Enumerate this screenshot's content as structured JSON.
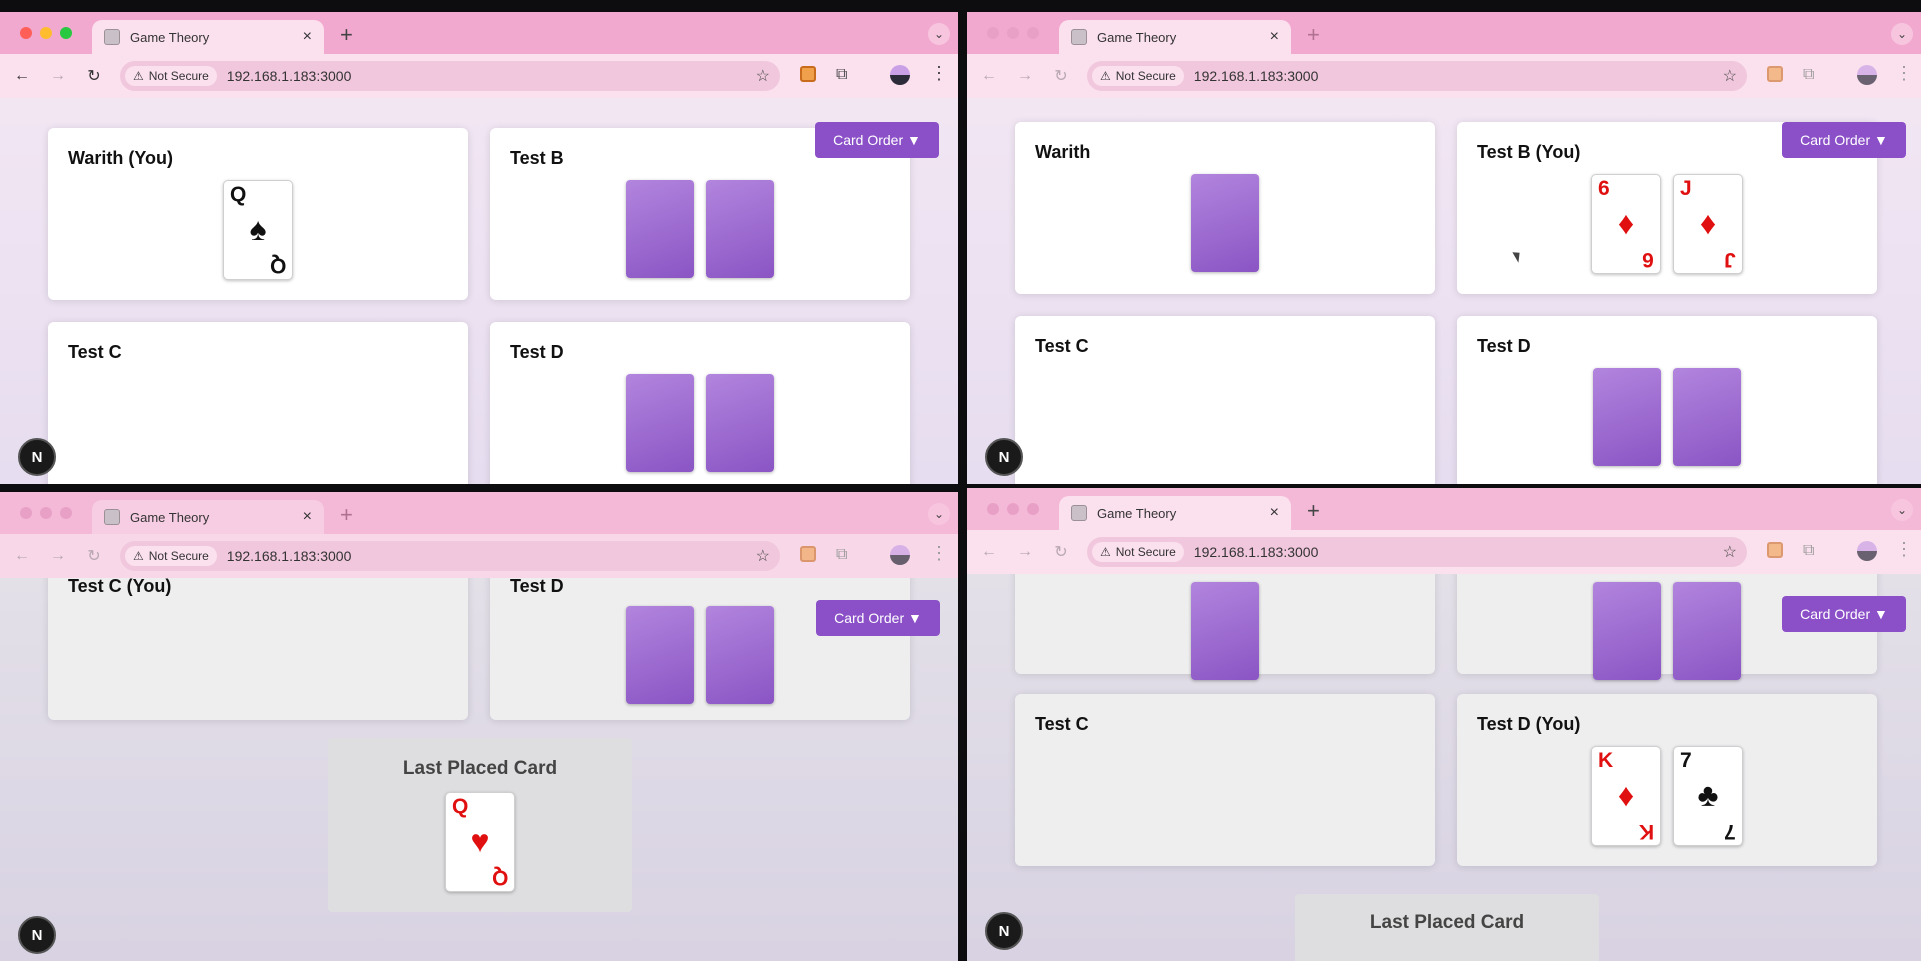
{
  "tab": {
    "title": "Game Theory"
  },
  "address": {
    "security": "Not Secure",
    "url": "192.168.1.183:3000"
  },
  "ui": {
    "card_order": "Card Order ▼",
    "last_placed": "Last Placed Card",
    "next_badge": "N"
  },
  "icons": {
    "back": "arrow-left-icon",
    "forward": "arrow-right-icon",
    "reload": "reload-icon",
    "star": "star-icon",
    "extension": "puzzle-icon",
    "menu": "kebab-icon",
    "warning": "warning-icon"
  },
  "colors": {
    "accent": "#8b50c8",
    "card_back": "#9b6bd3",
    "red_suit": "#e01010",
    "tab_strip": "#f2a9cf"
  },
  "windows": [
    {
      "players": [
        {
          "name": "Warith (You)",
          "cards": [
            {
              "rank": "Q",
              "suit": "♠",
              "color": "blk"
            }
          ]
        },
        {
          "name": "Test B",
          "backs": 2
        },
        {
          "name": "Test C",
          "backs": 0
        },
        {
          "name": "Test D",
          "backs": 2
        }
      ]
    },
    {
      "players": [
        {
          "name": "Warith",
          "backs": 1
        },
        {
          "name": "Test B (You)",
          "cards": [
            {
              "rank": "6",
              "suit": "♦",
              "color": "red"
            },
            {
              "rank": "J",
              "suit": "♦",
              "color": "red"
            }
          ]
        },
        {
          "name": "Test C",
          "backs": 0
        },
        {
          "name": "Test D",
          "backs": 2
        }
      ]
    },
    {
      "players": [
        {
          "name": "Test C (You)",
          "backs": 0
        },
        {
          "name": "Test D",
          "backs": 2
        }
      ],
      "last_card": {
        "rank": "Q",
        "suit": "♥",
        "color": "red"
      }
    },
    {
      "players": [
        {
          "name": "",
          "backs": 1
        },
        {
          "name": "",
          "backs": 2
        },
        {
          "name": "Test C",
          "backs": 0
        },
        {
          "name": "Test D (You)",
          "cards": [
            {
              "rank": "K",
              "suit": "♦",
              "color": "red"
            },
            {
              "rank": "7",
              "suit": "♣",
              "color": "blk"
            }
          ]
        }
      ]
    }
  ]
}
